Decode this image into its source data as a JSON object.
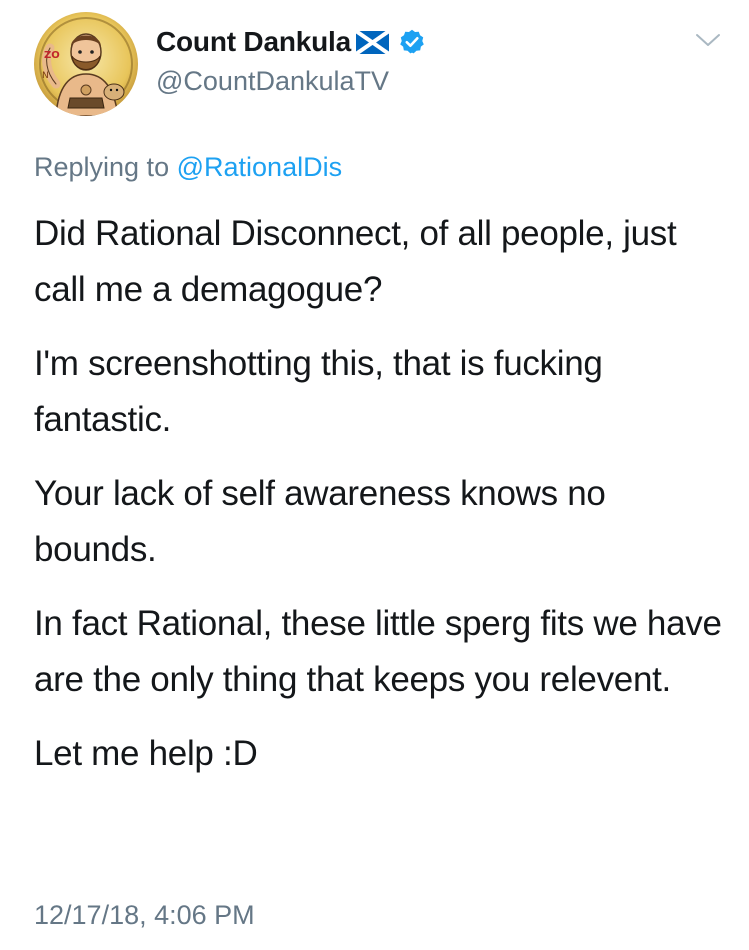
{
  "author": {
    "display_name": "Count Dankula",
    "handle": "@CountDankulaTV",
    "verified": true,
    "flag_icon": "scotland-flag-icon",
    "avatar_icon": "cartoon-avatar"
  },
  "reply": {
    "prefix": "Replying to",
    "mention": "@RationalDis"
  },
  "tweet": {
    "paragraphs": [
      "Did Rational Disconnect, of all people, just call me a demagogue?",
      "I'm screenshotting this, that is fucking fantastic.",
      "Your lack of self awareness knows no bounds.",
      "In fact Rational, these little sperg fits we have are the only thing that keeps you relevent.",
      "Let me help :D"
    ],
    "timestamp": "12/17/18, 4:06 PM"
  },
  "colors": {
    "text": "#14171a",
    "secondary": "#657786",
    "link": "#1da1f2",
    "verified": "#1da1f2",
    "flag_blue": "#0065bd"
  }
}
